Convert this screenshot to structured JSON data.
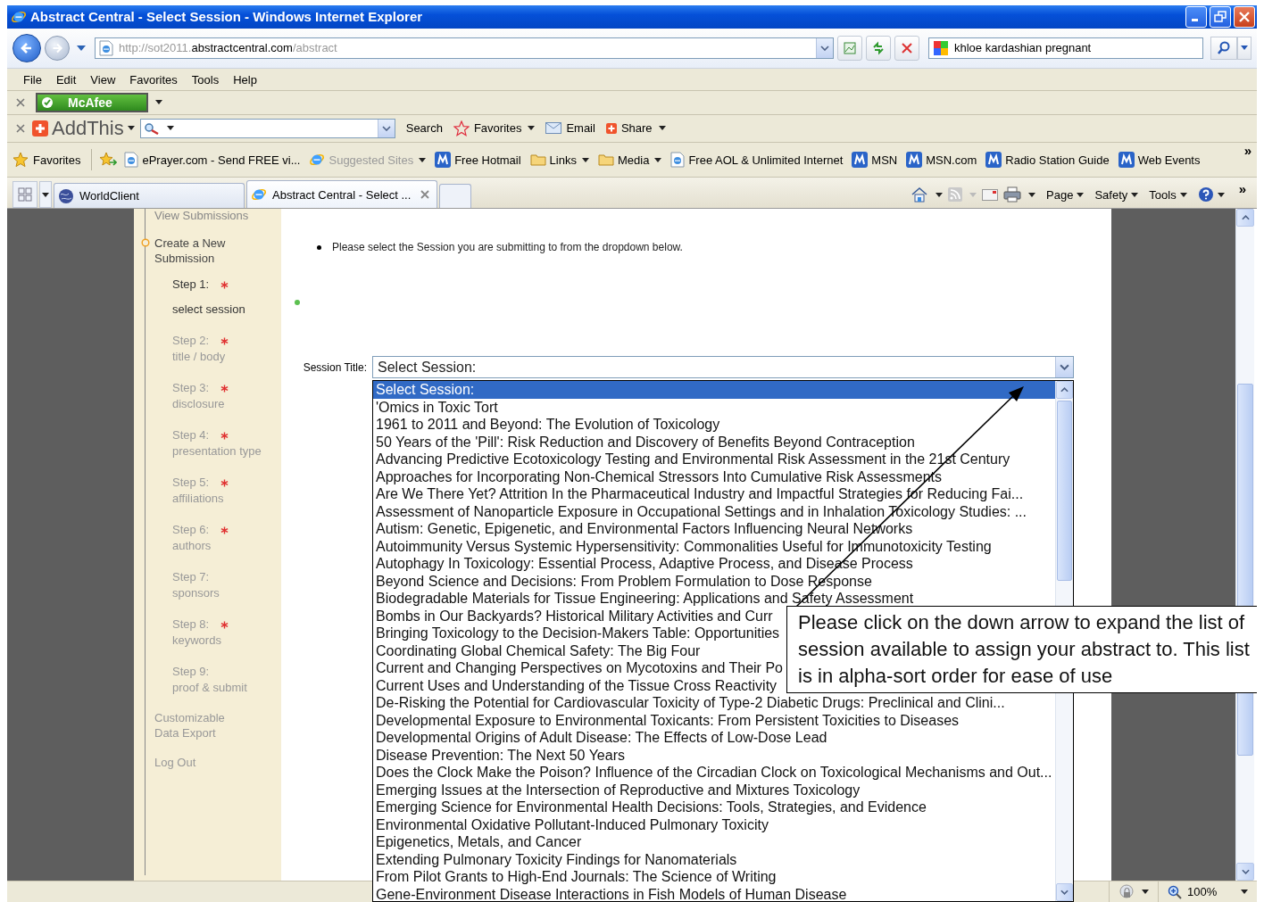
{
  "window": {
    "title": "Abstract Central - Select Session - Windows Internet Explorer"
  },
  "address_bar": {
    "url_prefix": "http://sot2011.",
    "url_domain": "abstractcentral.com",
    "url_path": "/abstract"
  },
  "search_box": {
    "value": "khloe kardashian pregnant"
  },
  "menu_bar": [
    "File",
    "Edit",
    "View",
    "Favorites",
    "Tools",
    "Help"
  ],
  "mcafee_toolbar": {
    "label": "McAfee"
  },
  "addthis_toolbar": {
    "logo": "AddThis",
    "items": [
      {
        "label": "Search",
        "kind": "plain",
        "dropdown": false
      },
      {
        "label": "Favorites",
        "kind": "star",
        "dropdown": true
      },
      {
        "label": "Email",
        "kind": "mail",
        "dropdown": false
      },
      {
        "label": "Share",
        "kind": "share",
        "dropdown": true
      }
    ]
  },
  "favorites_bar": {
    "label": "Favorites",
    "overflow": "»",
    "links": [
      {
        "label": "ePrayer.com - Send FREE vi...",
        "kind": "page",
        "dropdown": false,
        "dimmed": false
      },
      {
        "label": "Suggested Sites",
        "kind": "ie",
        "dropdown": true,
        "dimmed": true
      },
      {
        "label": "Free Hotmail",
        "kind": "tile",
        "dropdown": false,
        "dimmed": false
      },
      {
        "label": "Links",
        "kind": "folder",
        "dropdown": true,
        "dimmed": false
      },
      {
        "label": "Media",
        "kind": "folder",
        "dropdown": true,
        "dimmed": false
      },
      {
        "label": "Free AOL & Unlimited Internet",
        "kind": "page",
        "dropdown": false,
        "dimmed": false
      },
      {
        "label": "MSN",
        "kind": "tile",
        "dropdown": false,
        "dimmed": false
      },
      {
        "label": "MSN.com",
        "kind": "tile",
        "dropdown": false,
        "dimmed": false
      },
      {
        "label": "Radio Station Guide",
        "kind": "tile",
        "dropdown": false,
        "dimmed": false
      },
      {
        "label": "Web Events",
        "kind": "tile",
        "dropdown": false,
        "dimmed": false
      }
    ]
  },
  "tabs": [
    {
      "label": "WorldClient",
      "selected": false
    },
    {
      "label": "Abstract Central - Select ...",
      "selected": true
    }
  ],
  "command_bar": {
    "menus": [
      "Page",
      "Safety",
      "Tools"
    ],
    "overflow": "»"
  },
  "sidebar": {
    "top_link": "View Submissions",
    "section": "Create a New Submission",
    "steps": [
      {
        "label": "Step 1:",
        "detail": "select session",
        "required": true,
        "active": true
      },
      {
        "label": "Step 2:",
        "detail": "title / body",
        "required": true,
        "active": false
      },
      {
        "label": "Step 3:",
        "detail": "disclosure",
        "required": true,
        "active": false
      },
      {
        "label": "Step 4:",
        "detail": "presentation type",
        "required": true,
        "active": false
      },
      {
        "label": "Step 5:",
        "detail": "affiliations",
        "required": true,
        "active": false
      },
      {
        "label": "Step 6:",
        "detail": "authors",
        "required": true,
        "active": false
      },
      {
        "label": "Step 7:",
        "detail": "sponsors",
        "required": false,
        "active": false
      },
      {
        "label": "Step 8:",
        "detail": "keywords",
        "required": true,
        "active": false
      },
      {
        "label": "Step 9:",
        "detail": "proof & submit",
        "required": false,
        "active": false
      }
    ],
    "links": [
      "Customizable Data Export",
      "Log Out"
    ]
  },
  "instructions": "Please select the Session you are submitting to from the dropdown below.",
  "session_field": {
    "label": "Session Title:",
    "value": "Select Session:",
    "expanded": true
  },
  "session_options": [
    {
      "label": "Select Session:",
      "selected": true
    },
    {
      "label": "'Omics in Toxic Tort",
      "selected": false
    },
    {
      "label": "1961 to 2011 and Beyond: The Evolution of Toxicology",
      "selected": false
    },
    {
      "label": "50 Years of the 'Pill': Risk Reduction and Discovery of Benefits Beyond Contraception",
      "selected": false
    },
    {
      "label": "Advancing Predictive Ecotoxicology Testing and Environmental Risk Assessment in the 21st Century",
      "selected": false
    },
    {
      "label": "Approaches for Incorporating Non-Chemical Stressors Into Cumulative Risk Assessments",
      "selected": false
    },
    {
      "label": "Are We There Yet? Attrition In the Pharmaceutical Industry and Impactful Strategies for Reducing Fai...",
      "selected": false
    },
    {
      "label": "Assessment of Nanoparticle Exposure in Occupational Settings and in Inhalation Toxicology Studies: ...",
      "selected": false
    },
    {
      "label": "Autism: Genetic, Epigenetic, and Environmental Factors Influencing Neural Networks",
      "selected": false
    },
    {
      "label": "Autoimmunity Versus Systemic Hypersensitivity: Commonalities Useful for Immunotoxicity Testing",
      "selected": false
    },
    {
      "label": "Autophagy In Toxicology: Essential Process, Adaptive Process, and Disease Process",
      "selected": false
    },
    {
      "label": "Beyond Science and Decisions: From Problem Formulation to Dose Response",
      "selected": false
    },
    {
      "label": "Biodegradable Materials for Tissue Engineering: Applications and Safety Assessment",
      "selected": false
    },
    {
      "label": "Bombs in Our Backyards? Historical Military Activities and Curr",
      "selected": false
    },
    {
      "label": "Bringing Toxicology to the Decision-Makers Table: Opportunities",
      "selected": false
    },
    {
      "label": "Coordinating Global Chemical Safety: The Big Four",
      "selected": false
    },
    {
      "label": "Current and Changing Perspectives on Mycotoxins and Their Po",
      "selected": false
    },
    {
      "label": "Current Uses and Understanding of the Tissue Cross Reactivity",
      "selected": false
    },
    {
      "label": "De-Risking the Potential for Cardiovascular Toxicity of Type-2 Diabetic Drugs: Preclinical and Clini...",
      "selected": false
    },
    {
      "label": "Developmental Exposure to Environmental Toxicants: From Persistent Toxicities to Diseases",
      "selected": false
    },
    {
      "label": "Developmental Origins of Adult Disease: The Effects of Low-Dose Lead",
      "selected": false
    },
    {
      "label": "Disease Prevention: The Next 50 Years",
      "selected": false
    },
    {
      "label": "Does the Clock Make the Poison? Influence of the Circadian Clock on Toxicological Mechanisms and Out...",
      "selected": false
    },
    {
      "label": "Emerging Issues at the Intersection of Reproductive and Mixtures Toxicology",
      "selected": false
    },
    {
      "label": "Emerging Science for Environmental Health Decisions: Tools, Strategies, and Evidence",
      "selected": false
    },
    {
      "label": "Environmental Oxidative Pollutant-Induced Pulmonary Toxicity",
      "selected": false
    },
    {
      "label": "Epigenetics, Metals, and Cancer",
      "selected": false
    },
    {
      "label": "Extending Pulmonary Toxicity Findings for Nanomaterials",
      "selected": false
    },
    {
      "label": "From Pilot Grants to High-End Journals: The Science of Writing",
      "selected": false
    },
    {
      "label": "Gene-Environment Disease Interactions in Fish Models of Human Disease",
      "selected": false
    }
  ],
  "callout": "Please click on the down arrow to expand the list of session available to assign your abstract to. This list is in alpha-sort order for ease of use",
  "status_bar": {
    "zoom": "100%"
  }
}
